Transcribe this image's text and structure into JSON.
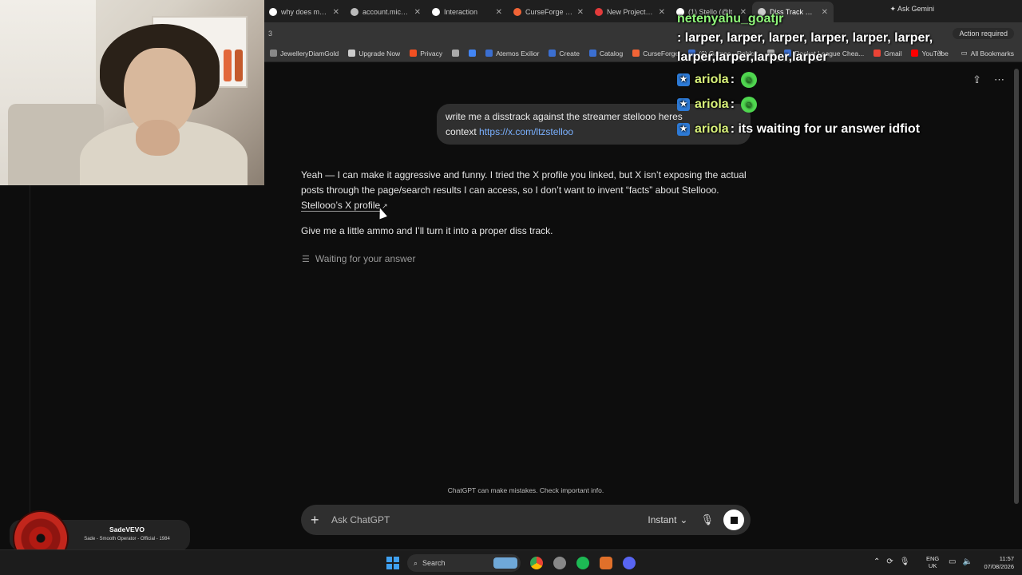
{
  "browser": {
    "tabs": [
      {
        "label": "why does my p",
        "color": "#ffffff"
      },
      {
        "label": "account.micros",
        "color": "#bbbbbb"
      },
      {
        "label": "Interaction",
        "color": "#ffffff"
      },
      {
        "label": "CurseForge - M",
        "color": "#f16436"
      },
      {
        "label": "New Project - S",
        "color": "#e33b3b"
      },
      {
        "label": "(1) Stello (@lt",
        "color": "#ffffff"
      },
      {
        "label": "Diss Track Req",
        "color": "#cccccc"
      }
    ],
    "gemini_label": "Ask Gemini",
    "address_fragment": "3",
    "action_required": "Action required",
    "bookmarks": [
      {
        "label": "JewelleryDiamGold",
        "color": "#888888"
      },
      {
        "label": "Upgrade Now",
        "color": "#cccccc"
      },
      {
        "label": "Privacy",
        "color": "#f25022"
      },
      {
        "label": "",
        "color": "#aaaaaa"
      },
      {
        "label": "",
        "color": "#4285f4"
      },
      {
        "label": "Atemos Exilior",
        "color": "#3b6fd1"
      },
      {
        "label": "Create",
        "color": "#3b6fd1"
      },
      {
        "label": "Catalog",
        "color": "#3b6fd1"
      },
      {
        "label": "CurseForge",
        "color": "#f16436"
      },
      {
        "label": "(6) Games - Roblox",
        "color": "#3b6fd1"
      },
      {
        "label": "",
        "color": "#aaaaaa"
      },
      {
        "label": "Rocket League Chea...",
        "color": "#3b6fd1"
      },
      {
        "label": "Gmail",
        "color": "#ea4335"
      },
      {
        "label": "YouTube",
        "color": "#ff0000"
      }
    ],
    "all_bookmarks": "All Bookmarks"
  },
  "chat": {
    "user_message": "write me a disstrack against the streamer stellooo heres",
    "user_message_cont": "context",
    "user_link": "https://x.com/ltzstelloo",
    "assistant_p1": "Yeah — I can make it aggressive and funny. I tried the X profile you linked, but X isn’t exposing the actual posts through the page/search results I can access, so I don’t want to invent “facts” about Stellooo.",
    "assistant_link": "Stellooo’s X profile",
    "assistant_p2": "Give me a little ammo and I’ll turn it into a proper diss track.",
    "waiting": "Waiting for your answer",
    "disclaimer": "ChatGPT can make mistakes. Check important info.",
    "composer_placeholder": "Ask ChatGPT",
    "mode": "Instant"
  },
  "overlay": {
    "line1_user": "netenyahu_goatjr",
    "line1_msg": ": larper, larper, larper, larper, larper, larper, larper,larper,larper,larper",
    "line2_user": "ariola",
    "line2_msg": ":",
    "line3_user": "ariola",
    "line3_msg": ":",
    "line4_user": "ariola",
    "line4_msg": ": its waiting for ur answer idfiot"
  },
  "nowplaying": {
    "artist": "SadeVEVO",
    "title": "Sade - Smooth Operator - Official - 1984"
  },
  "taskbar": {
    "search": "Search",
    "lang1": "ENG",
    "lang2": "UK",
    "time": "11:57",
    "date": "07/08/2026"
  },
  "colors": {
    "accent_link": "#7ab0ff",
    "chat_name_green": "#8ff57a",
    "user_bubble": "#2f2f2f",
    "background": "#0d0d0d"
  }
}
